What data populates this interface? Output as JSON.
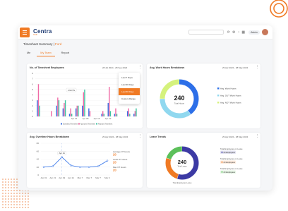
{
  "app": {
    "logo": "Centra",
    "logo_sub": "HUB",
    "user_label": "Admin",
    "menu_icon": "hamburger-icon"
  },
  "breadcrumb": {
    "title": "Timesheet Summary",
    "sep": "|",
    "current": "Ford"
  },
  "tabs": [
    {
      "label": "Me",
      "active": false
    },
    {
      "label": "My Team",
      "active": true
    },
    {
      "label": "Report",
      "active": false
    }
  ],
  "timesheet_card": {
    "title": "No. of Timesheet Employees",
    "date": "28 Jul 2024 - 28 Sep 2024",
    "yticks": [
      "8",
      "7",
      "6",
      "5",
      "4",
      "3",
      "2",
      "1",
      "0"
    ],
    "xlabels": [
      "Apr 01",
      "Apr 08",
      "Apr 15",
      "Apr 22"
    ],
    "tooltip": "6 NOTS",
    "legend": [
      "Submitted Timesheet",
      "Approved Timesheet",
      "Rejected Timesheet"
    ],
    "dropdown": [
      "Last 7 Days",
      "Last 30 Days",
      "Last 60 Days",
      "Custom Range"
    ],
    "dropdown_selected": 2
  },
  "donut1": {
    "title": "Avg. Work Hours Breakdown",
    "date": "29 Apr 2024 - 28 May 2024",
    "center_value": "240",
    "center_label": "Total Hours",
    "legend": [
      "Avg. Work Hours",
      "Avg. OUT Work Hours",
      "Avg. NOT Work Hours"
    ]
  },
  "line_card": {
    "title": "Avg. Overtime Hours Breakdown",
    "date": "29 Apr 2024 - 28 May 2024",
    "yticks": [
      "80",
      "60",
      "40",
      "20",
      "0"
    ],
    "xlabels": [
      "Apr 01",
      "Apr 21",
      "Apr 29",
      "Apr 21",
      "Mar 7",
      "Mar 7",
      "Mar 7",
      "Mar 2"
    ],
    "tooltip": "Apr 21",
    "stats": [
      {
        "label": "Average OT Hours",
        "value": "20"
      },
      {
        "label": "Least OT Hours",
        "value": "20"
      },
      {
        "label": "Max OT Hours",
        "value": "20"
      }
    ]
  },
  "donut2": {
    "title": "Leave Trends",
    "date": "29 Apr 2024 - 28 May 2024",
    "center_value": "240",
    "center_label": "Total Leave",
    "bottom_label": "Total Employees Leave",
    "legend": [
      {
        "label": "Total Employees on Leave",
        "badge": "20 Employees"
      },
      {
        "label": "Total Employees on Leave",
        "badge": "20 Employees"
      },
      {
        "label": "Total Employees on Leave",
        "badge": "20 Employees"
      }
    ]
  },
  "chart_data": [
    {
      "type": "bar",
      "title": "No. of Timesheet Employees",
      "categories": [
        "1",
        "2",
        "3",
        "4",
        "5",
        "6",
        "7",
        "8",
        "9",
        "10",
        "11",
        "12",
        "13",
        "14",
        "15",
        "16"
      ],
      "ylim": [
        0,
        8
      ],
      "series": [
        {
          "name": "Submitted Timesheet",
          "color": "#3b6fe0",
          "values": [
            3,
            0,
            0,
            2,
            1.5,
            0.5,
            1.5,
            2,
            1.5,
            0,
            0.5,
            2.5,
            0.5,
            0,
            1,
            0.5
          ]
        },
        {
          "name": "Approved Timesheet",
          "color": "#f06aa6",
          "values": [
            6,
            0,
            1,
            3.5,
            2.5,
            1.5,
            2,
            4.5,
            1,
            0,
            1,
            5.5,
            1.5,
            0,
            1.5,
            1
          ]
        },
        {
          "name": "Rejected Timesheet",
          "color": "#3cc3a0",
          "values": [
            2,
            0,
            0,
            3,
            3,
            0.5,
            2,
            5,
            0,
            0,
            0.5,
            1,
            0.5,
            0,
            0.5,
            1.5
          ]
        }
      ]
    },
    {
      "type": "pie",
      "title": "Avg. Work Hours Breakdown",
      "labels": [
        "Avg. Work Hours",
        "Avg. OUT Work Hours",
        "Avg. NOT Work Hours"
      ],
      "values": [
        40,
        35,
        25
      ],
      "colors": [
        "#2d6fe8",
        "#90d8ef",
        "#d5f27c"
      ]
    },
    {
      "type": "line",
      "title": "Avg. Overtime Hours Breakdown",
      "categories": [
        "Apr 01",
        "Apr 21",
        "Apr 29",
        "Apr 21",
        "Mar 7",
        "Mar 7",
        "Mar 7",
        "Mar 2"
      ],
      "ylim": [
        0,
        80
      ],
      "series": [
        {
          "name": "",
          "color": "#2d6fe8",
          "values": [
            20,
            22,
            45,
            24,
            20,
            20,
            22,
            36
          ]
        }
      ]
    },
    {
      "type": "pie",
      "title": "Leave Trends",
      "labels": [
        "Total Employees on Leave",
        "Total Employees on Leave",
        "Total Employees on Leave"
      ],
      "values": [
        55,
        25,
        20
      ],
      "colors": [
        "#3c3aa4",
        "#f07a24",
        "#5cc05a"
      ]
    }
  ]
}
